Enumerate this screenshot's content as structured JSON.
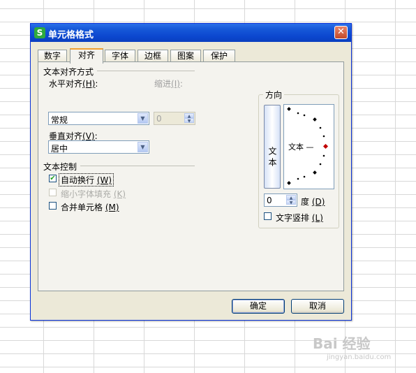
{
  "dialog": {
    "title": "单元格格式",
    "app_icon_letter": "S"
  },
  "tabs": [
    "数字",
    "对齐",
    "字体",
    "边框",
    "图案",
    "保护"
  ],
  "alignment": {
    "section_title": "文本对齐方式",
    "horizontal_label": "水平对齐",
    "horizontal_key": "(H)",
    "horizontal_value": "常规",
    "indent_label": "缩进",
    "indent_key": "(I)",
    "indent_value": "0",
    "vertical_label": "垂直对齐",
    "vertical_key": "(V)",
    "vertical_value": "居中"
  },
  "text_control": {
    "section_title": "文本控制",
    "wrap_label": "自动换行",
    "wrap_key": "(W)",
    "wrap_checked": true,
    "shrink_label": "缩小字体填充",
    "shrink_key": "(K)",
    "shrink_checked": false,
    "merge_label": "合并单元格",
    "merge_key": "(M)",
    "merge_checked": false
  },
  "orientation": {
    "section_title": "方向",
    "vertical_text_sample": "文本",
    "dial_text": "文本 —",
    "degrees_value": "0",
    "degrees_label": "度",
    "degrees_key": "(D)",
    "vertical_text_checkbox": "文字竖排",
    "vertical_text_key": "(L)",
    "vertical_text_checked": false
  },
  "buttons": {
    "ok": "确定",
    "cancel": "取消"
  },
  "colors": {
    "titlebar": "#0b47cf",
    "dialog_bg": "#ece9d8",
    "active_tab_accent": "#f0a030",
    "dial_marker": "#c00000"
  },
  "watermark": {
    "text": "Bai 经验",
    "url": "jingyan.baidu.com"
  }
}
